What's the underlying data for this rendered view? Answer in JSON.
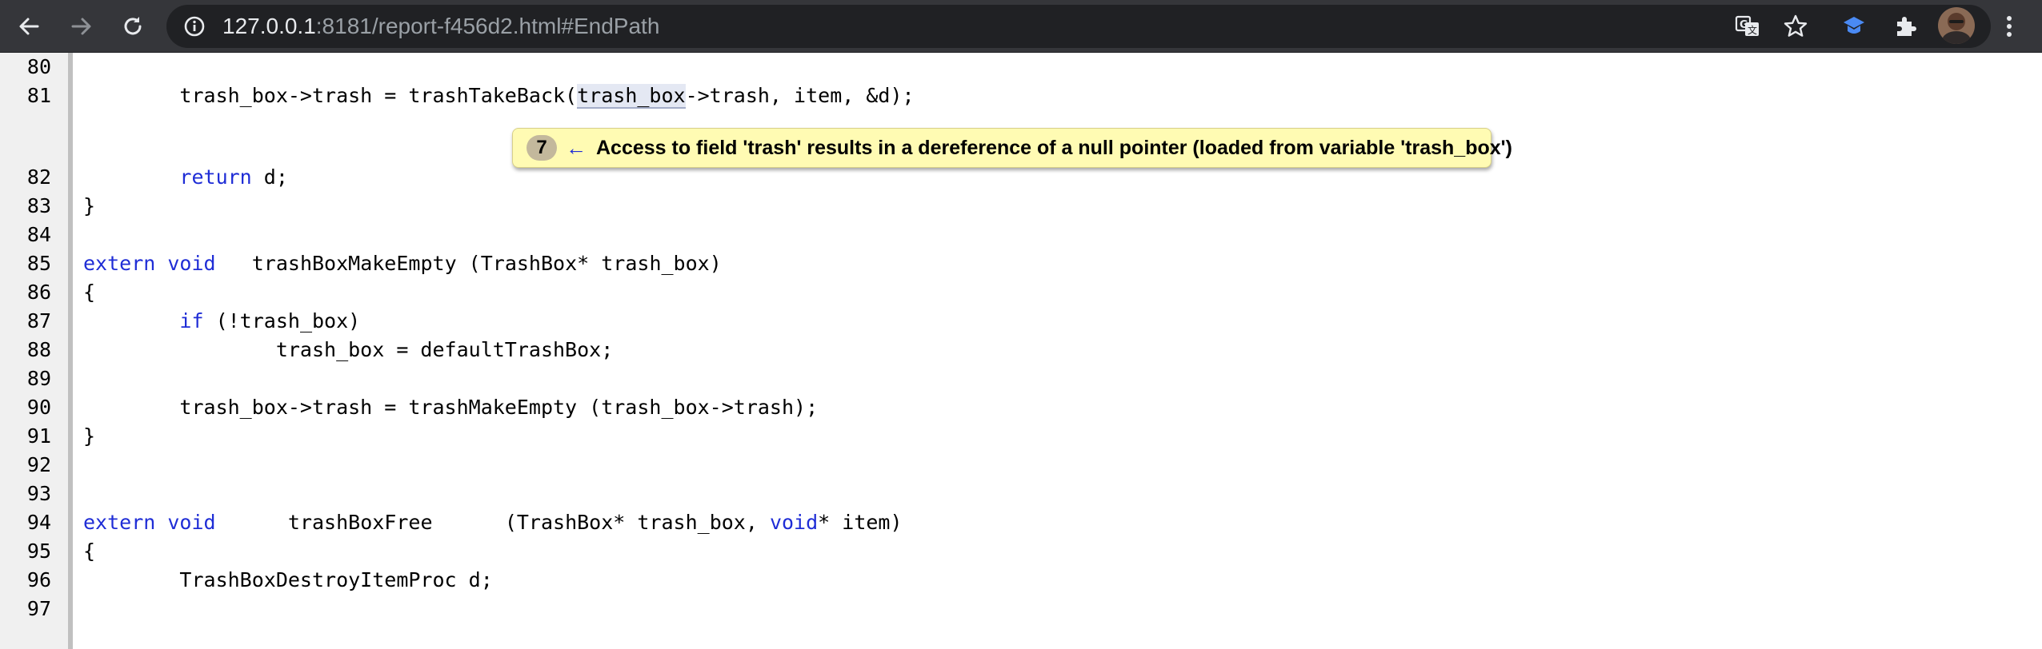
{
  "browser": {
    "url_host": "127.0.0.1",
    "url_rest": ":8181/report-f456d2.html#EndPath",
    "icons": {
      "back": "back-arrow-icon",
      "forward": "forward-arrow-icon",
      "reload": "reload-icon",
      "site_info": "info-icon",
      "translate": "translate-icon",
      "bookmark": "star-icon",
      "extension_1": "blue-extension-icon",
      "extensions": "puzzle-icon",
      "menu": "kebab-menu-icon"
    }
  },
  "colors": {
    "keyword": "#1f2dd6",
    "bubble_background": "#fffbb3",
    "gutter_background": "#f0f0f0"
  },
  "code": {
    "lines": [
      {
        "number": "80",
        "segments": [
          {
            "text": ""
          }
        ]
      },
      {
        "number": "81",
        "segments": [
          {
            "text": "        trash_box->trash = trashTakeBack("
          },
          {
            "text": "trash_box",
            "highlight": true
          },
          {
            "text": "->trash, item, &d);"
          }
        ]
      },
      {
        "number": "82",
        "segments": [
          {
            "text": "        "
          },
          {
            "text": "return",
            "kw": true
          },
          {
            "text": " d;"
          }
        ]
      },
      {
        "number": "83",
        "segments": [
          {
            "text": "}"
          }
        ]
      },
      {
        "number": "84",
        "segments": [
          {
            "text": ""
          }
        ]
      },
      {
        "number": "85",
        "segments": [
          {
            "text": "extern",
            "kw": true
          },
          {
            "text": " "
          },
          {
            "text": "void",
            "kw": true
          },
          {
            "text": "   trashBoxMakeEmpty (TrashBox* trash_box)"
          }
        ]
      },
      {
        "number": "86",
        "segments": [
          {
            "text": "{"
          }
        ]
      },
      {
        "number": "87",
        "segments": [
          {
            "text": "        "
          },
          {
            "text": "if",
            "kw": true
          },
          {
            "text": " (!trash_box)"
          }
        ]
      },
      {
        "number": "88",
        "segments": [
          {
            "text": "                trash_box = defaultTrashBox;"
          }
        ]
      },
      {
        "number": "89",
        "segments": [
          {
            "text": ""
          }
        ]
      },
      {
        "number": "90",
        "segments": [
          {
            "text": "        trash_box->trash = trashMakeEmpty (trash_box->trash);"
          }
        ]
      },
      {
        "number": "91",
        "segments": [
          {
            "text": "}"
          }
        ]
      },
      {
        "number": "92",
        "segments": [
          {
            "text": ""
          }
        ]
      },
      {
        "number": "93",
        "segments": [
          {
            "text": ""
          }
        ]
      },
      {
        "number": "94",
        "segments": [
          {
            "text": "extern",
            "kw": true
          },
          {
            "text": " "
          },
          {
            "text": "void",
            "kw": true
          },
          {
            "text": "      trashBoxFree      (TrashBox* trash_box, "
          },
          {
            "text": "void",
            "kw": true
          },
          {
            "text": "* item)"
          }
        ]
      },
      {
        "number": "95",
        "segments": [
          {
            "text": "{"
          }
        ]
      },
      {
        "number": "96",
        "segments": [
          {
            "text": "        TrashBoxDestroyItemProc d;"
          }
        ]
      },
      {
        "number": "97",
        "segments": [
          {
            "text": ""
          }
        ]
      }
    ]
  },
  "diagnostic": {
    "step": "7",
    "arrow": "←",
    "message": "Access to field 'trash' results in a dereference of a null pointer (loaded from variable 'trash_box')"
  }
}
